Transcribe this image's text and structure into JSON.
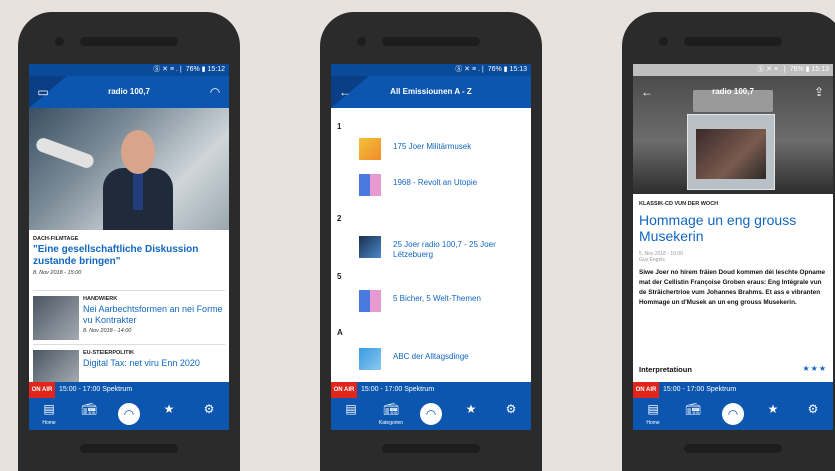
{
  "status": {
    "s1": "Ⓢ ✕ ≡ .❘ 76% ▮ 15:12",
    "s2": "Ⓢ ✕ ≡ .❘ 76% ▮ 15:13",
    "s3": "Ⓢ ✕ ≡ .❘ 76% ▮ 15:13"
  },
  "screen1": {
    "title": "radio 100,7",
    "hero_tag": "DACH-FILMTAGE",
    "hero_headline": "\"Eine gesellschaftliche Diskussion zustande bringen\"",
    "hero_date": "8. Nov 2018 - 15:00",
    "articles": [
      {
        "tag": "HANDWIERK",
        "headline": "Nei Aarbechtsformen an nei Forme vu Kontrakter",
        "date": "8. Nov 2018 - 14:00"
      },
      {
        "tag": "EU-STEIERPOLITIK",
        "headline": "Digital Tax: net viru Enn 2020"
      }
    ]
  },
  "screen2": {
    "title": "All Emissiounen A - Z",
    "groups": [
      {
        "letter": "1",
        "items": [
          "175 Joer Militärmusek",
          "1968 - Revolt an Utopie"
        ]
      },
      {
        "letter": "2",
        "items": [
          "25 Joer radio 100,7 - 25 Joer Lëtzebuerg"
        ]
      },
      {
        "letter": "5",
        "items": [
          "5 Bicher, 5 Welt-Themen"
        ]
      },
      {
        "letter": "A",
        "items": [
          "ABC der Alltagsdinge"
        ]
      }
    ]
  },
  "screen3": {
    "title": "radio 100,7",
    "tag": "KLASSIK-CD VUN DER WOCH",
    "headline": "Hommage un eng grouss Musekerin",
    "meta_date": "5. Nov 2018 - 10:00",
    "meta_author": "Guy Engels",
    "body": "Siwe Joer no hirem fräien Doud kommen déi leschte Opname mat der Cellistin Françoise Groben eraus: Eng Intégrale vun de Sträichertrioe vum Johannes Brahms. Et ass e vibranten Hommage un d'Musek an un eng grouss Musekerin.",
    "section": "Interpretatioun",
    "stars": "★★★"
  },
  "onair": {
    "badge": "ON AIR",
    "text": "15:00 - 17:00  Spektrum"
  },
  "nav": {
    "home": "Home",
    "kategorien": "Kategorien"
  },
  "icons": {
    "calendar": "calendar-icon",
    "headphones": "headphones-icon",
    "back": "back-arrow-icon",
    "share": "share-icon",
    "radio": "radio-icon",
    "star": "star-icon",
    "gear": "gear-icon"
  },
  "colors": {
    "primary": "#0c56b0",
    "onair": "#e0251b",
    "link": "#1167c0"
  }
}
